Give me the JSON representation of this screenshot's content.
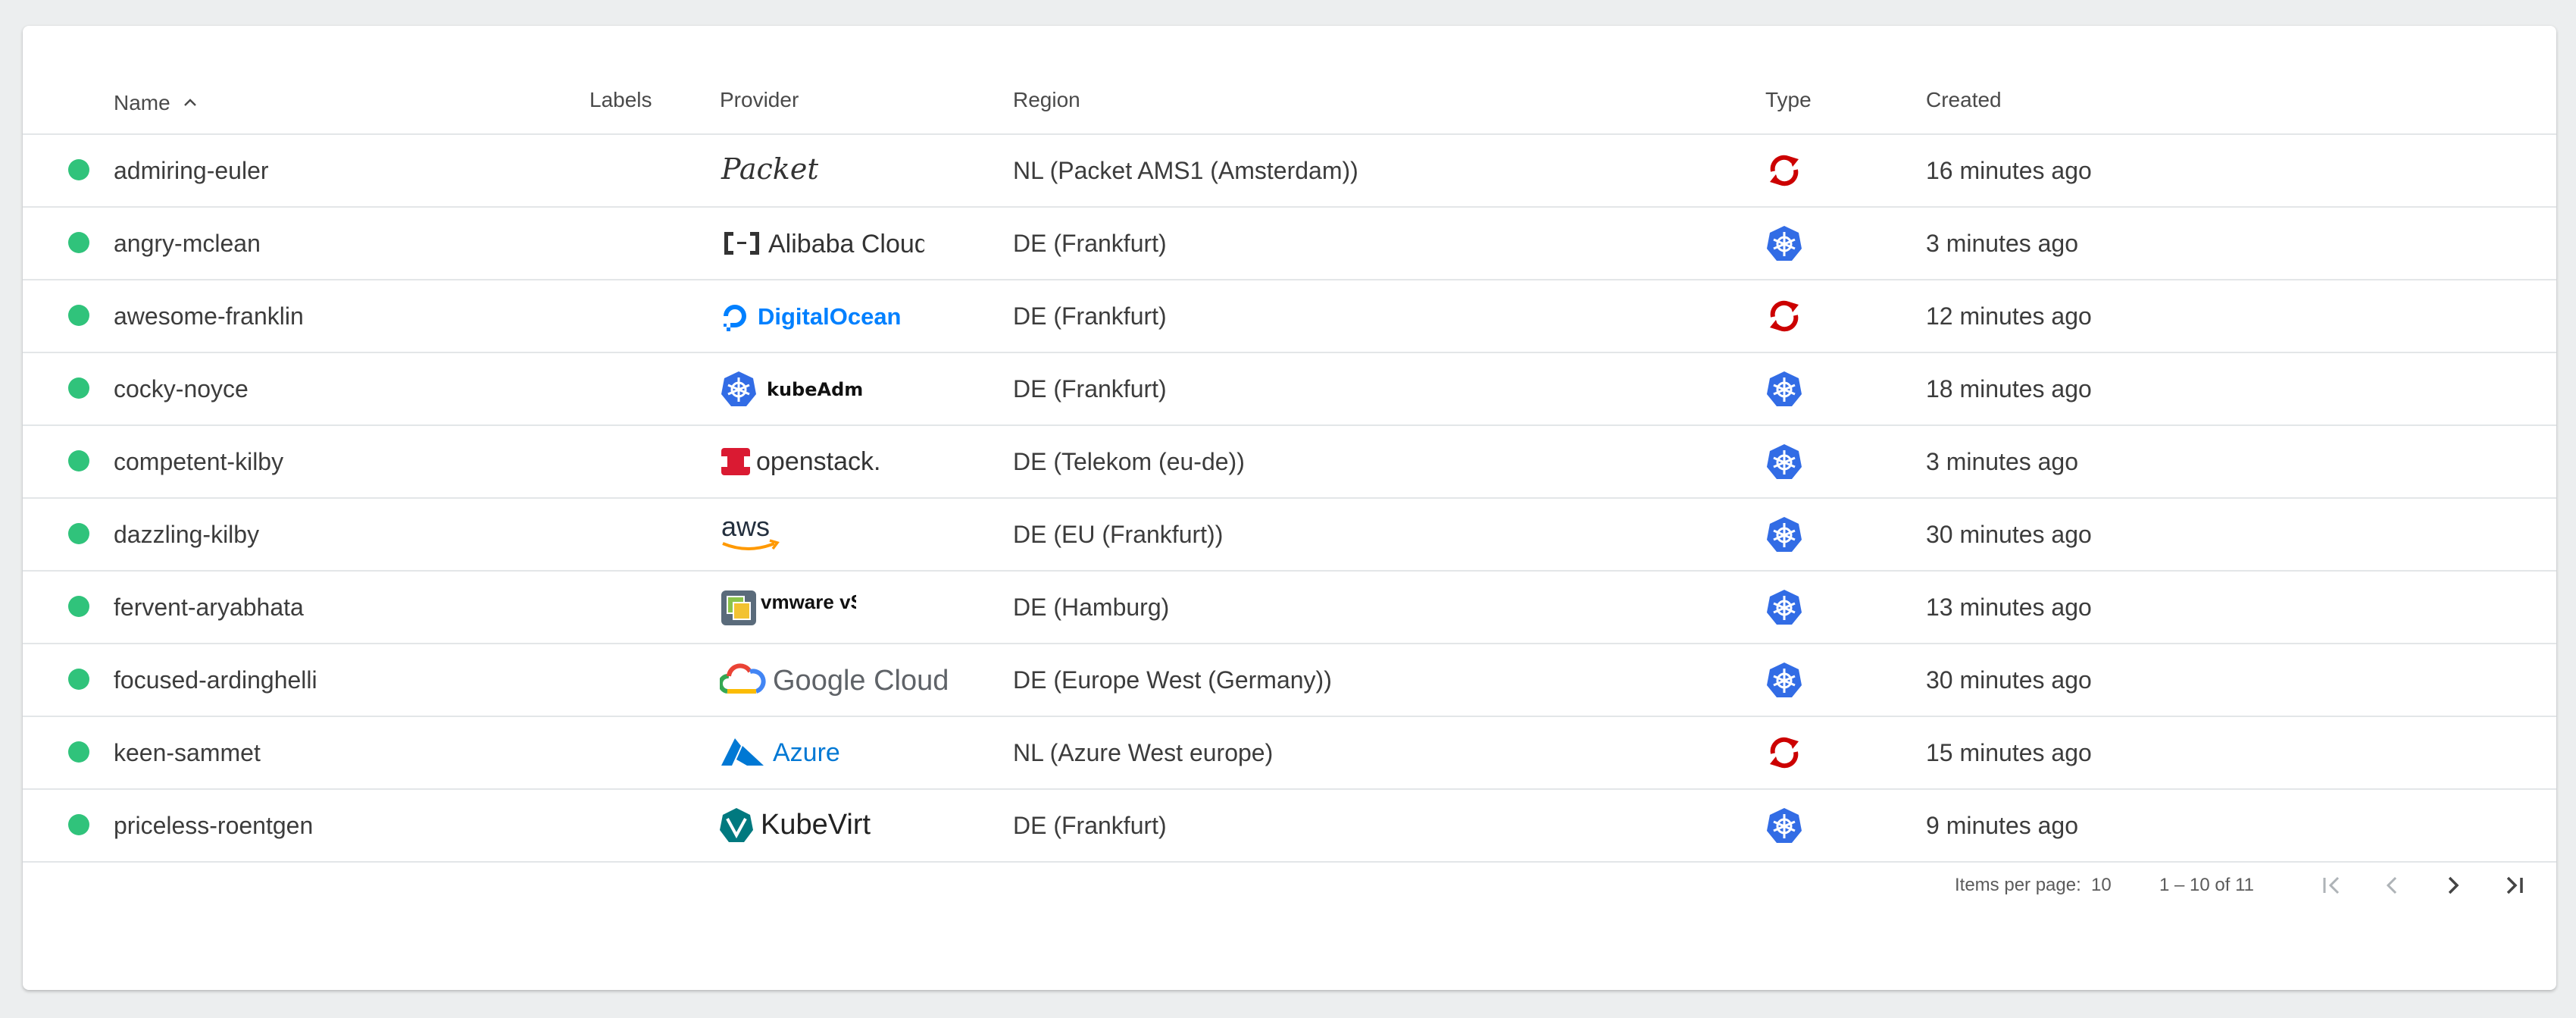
{
  "table": {
    "headers": {
      "name": "Name",
      "labels": "Labels",
      "provider": "Provider",
      "region": "Region",
      "type": "Type",
      "created": "Created"
    },
    "sort": {
      "column": "name",
      "direction": "ascending",
      "icon": "chevron-up-icon"
    },
    "rows": [
      {
        "status": "running",
        "name": "admiring-euler",
        "provider": "Packet",
        "provider_icon": "packet-logo",
        "region": "NL (Packet AMS1 (Amsterdam))",
        "type": "openshift-icon",
        "created": "16 minutes ago"
      },
      {
        "status": "running",
        "name": "angry-mclean",
        "provider": "Alibaba Cloud",
        "provider_icon": "alibaba-cloud-logo",
        "region": "DE (Frankfurt)",
        "type": "kubernetes-icon",
        "created": "3 minutes ago"
      },
      {
        "status": "running",
        "name": "awesome-franklin",
        "provider": "DigitalOcean",
        "provider_icon": "digitalocean-logo",
        "region": "DE (Frankfurt)",
        "type": "openshift-icon",
        "created": "12 minutes ago"
      },
      {
        "status": "running",
        "name": "cocky-noyce",
        "provider": "kubeAdm",
        "provider_icon": "kubeadm-logo",
        "region": "DE (Frankfurt)",
        "type": "kubernetes-icon",
        "created": "18 minutes ago"
      },
      {
        "status": "running",
        "name": "competent-kilby",
        "provider": "openstack.",
        "provider_icon": "openstack-logo",
        "region": "DE (Telekom (eu-de))",
        "type": "kubernetes-icon",
        "created": "3 minutes ago"
      },
      {
        "status": "running",
        "name": "dazzling-kilby",
        "provider": "aws",
        "provider_icon": "aws-logo",
        "region": "DE (EU (Frankfurt))",
        "type": "kubernetes-icon",
        "created": "30 minutes ago"
      },
      {
        "status": "running",
        "name": "fervent-aryabhata",
        "provider": "vmware vSphere",
        "provider_icon": "vmware-vsphere-logo",
        "region": "DE (Hamburg)",
        "type": "kubernetes-icon",
        "created": "13 minutes ago"
      },
      {
        "status": "running",
        "name": "focused-ardinghelli",
        "provider": "Google Cloud",
        "provider_icon": "google-cloud-logo",
        "region": "DE (Europe West (Germany))",
        "type": "kubernetes-icon",
        "created": "30 minutes ago"
      },
      {
        "status": "running",
        "name": "keen-sammet",
        "provider": "Azure",
        "provider_icon": "azure-logo",
        "region": "NL (Azure West europe)",
        "type": "openshift-icon",
        "created": "15 minutes ago"
      },
      {
        "status": "running",
        "name": "priceless-roentgen",
        "provider": "KubeVirt",
        "provider_icon": "kubevirt-logo",
        "region": "DE (Frankfurt)",
        "type": "kubernetes-icon",
        "created": "9 minutes ago"
      }
    ]
  },
  "paginator": {
    "items_per_page_label": "Items per page:",
    "items_per_page": "10",
    "range": "1 – 10 of 11"
  },
  "colors": {
    "status_running": "#30c37b",
    "kubernetes": "#326ce5",
    "openshift": "#cc0000",
    "digitalocean": "#0080ff",
    "azure": "#0078d4",
    "openstack": "#da1a32",
    "aws_orange": "#ff9900"
  }
}
